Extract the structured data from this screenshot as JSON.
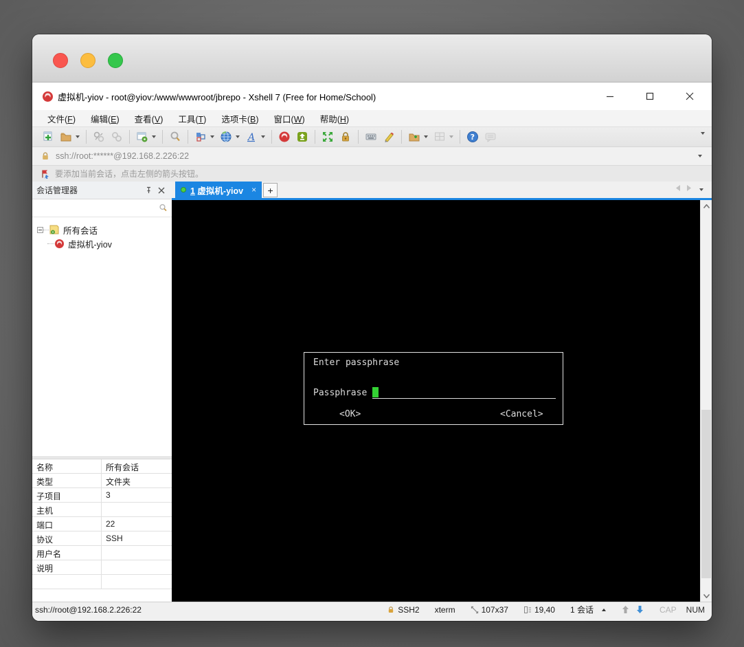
{
  "colors": {
    "accent_blue": "#1b86e2",
    "terminal_green": "#33d133",
    "tab_green": "#4fd045",
    "lock_gold": "#d9a33c"
  },
  "window": {
    "title": "虚拟机-yiov - root@yiov:/www/wwwroot/jbrepo - Xshell 7 (Free for Home/School)"
  },
  "menu": {
    "items": [
      {
        "pre": "文件(",
        "key": "F",
        "post": ")"
      },
      {
        "pre": "编辑(",
        "key": "E",
        "post": ")"
      },
      {
        "pre": "查看(",
        "key": "V",
        "post": ")"
      },
      {
        "pre": "工具(",
        "key": "T",
        "post": ")"
      },
      {
        "pre": "选项卡(",
        "key": "B",
        "post": ")"
      },
      {
        "pre": "窗口(",
        "key": "W",
        "post": ")"
      },
      {
        "pre": "帮助(",
        "key": "H",
        "post": ")"
      }
    ]
  },
  "toolbar": {
    "icons": [
      "new-session",
      "open-folder",
      "disconnect",
      "reconnect",
      "session-properties",
      "find",
      "color-scheme",
      "web-browser",
      "font",
      "xshell",
      "xftp",
      "fullscreen",
      "lock-screen",
      "virtual-keyboard",
      "compose",
      "new-file",
      "tile-windows",
      "help",
      "feedback"
    ]
  },
  "address_bar": {
    "url": "ssh://root:******@192.168.2.226:22"
  },
  "tip_bar": {
    "text": "要添加当前会话，点击左侧的箭头按钮。"
  },
  "session_manager": {
    "title": "会话管理器",
    "search_value": "",
    "tree": {
      "root": "所有会话",
      "child": "虚拟机-yiov"
    }
  },
  "tabs": {
    "active": {
      "key": "1",
      "rest": " 虚拟机-yiov",
      "close": "×"
    },
    "new_tab_label": "+"
  },
  "terminal": {
    "dialog": {
      "title": "Enter passphrase",
      "field_label": "Passphrase",
      "ok": "<OK>",
      "cancel": "<Cancel>"
    }
  },
  "properties": {
    "rows": [
      {
        "label": "名称",
        "value": "所有会话"
      },
      {
        "label": "类型",
        "value": "文件夹"
      },
      {
        "label": "子项目",
        "value": "3"
      },
      {
        "label": "主机",
        "value": ""
      },
      {
        "label": "端口",
        "value": "22"
      },
      {
        "label": "协议",
        "value": "SSH"
      },
      {
        "label": "用户名",
        "value": ""
      },
      {
        "label": "说明",
        "value": ""
      }
    ]
  },
  "status_bar": {
    "url": "ssh://root@192.168.2.226:22",
    "encryption": "SSH2",
    "terminal_type": "xterm",
    "size": "107x37",
    "cursor_pos": "19,40",
    "sessions": "1 会话",
    "cap": "CAP",
    "num": "NUM"
  }
}
